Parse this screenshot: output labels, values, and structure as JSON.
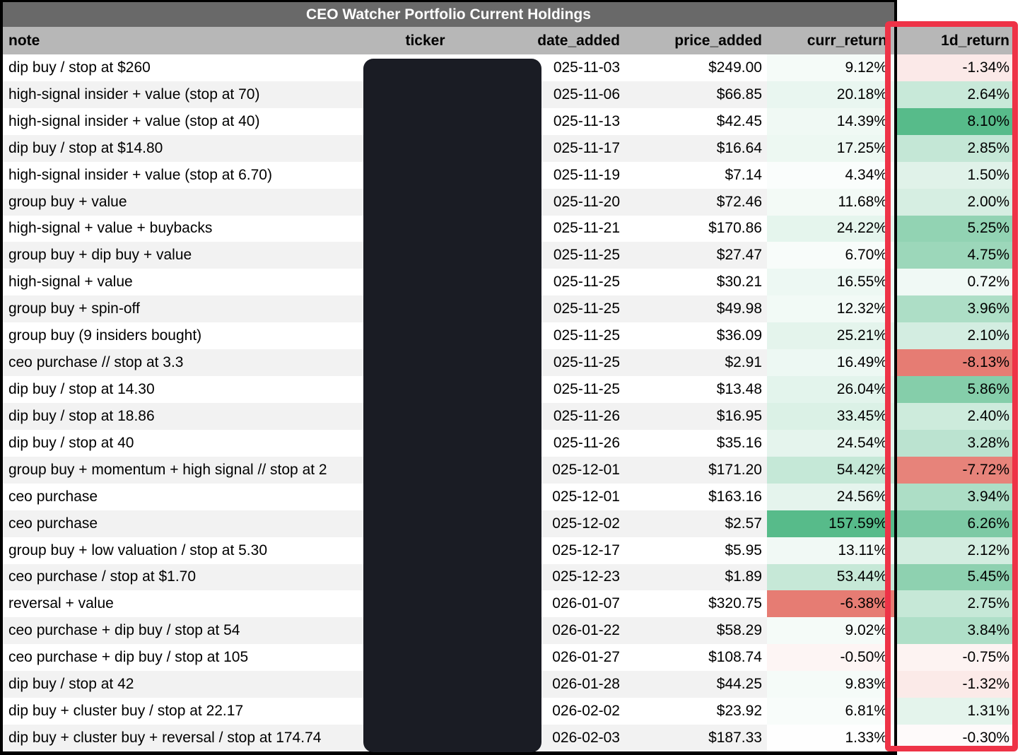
{
  "title": "CEO Watcher Portfolio Current Holdings",
  "columns": {
    "note": "note",
    "ticker": "ticker",
    "date_added": "date_added",
    "price_added": "price_added",
    "curr_return": "curr_return",
    "d1_return": "1d_return"
  },
  "colors": {
    "title_bg": "#696969",
    "header_bg": "#b7b7b7",
    "stripe": "#f2f2f2",
    "border": "#000000",
    "redaction_box": "#1a1c24",
    "highlight_frame": "#ee3347",
    "scale_positive": "#57bb8a",
    "scale_negative": "#e67c73"
  },
  "annotations": {
    "redacted_column": "ticker",
    "highlighted_column": "1d_return"
  },
  "rows": [
    {
      "note": "dip buy / stop at $260",
      "ticker": "",
      "date_added": "025-11-03",
      "price_added": "$249.00",
      "curr_return": 9.12,
      "d1_return": -1.34
    },
    {
      "note": "high-signal insider + value (stop at 70)",
      "ticker": "",
      "date_added": "025-11-06",
      "price_added": "$66.85",
      "curr_return": 20.18,
      "d1_return": 2.64
    },
    {
      "note": "high-signal insider + value (stop at 40)",
      "ticker": "",
      "date_added": "025-11-13",
      "price_added": "$42.45",
      "curr_return": 14.39,
      "d1_return": 8.1
    },
    {
      "note": "dip buy / stop at $14.80",
      "ticker": "",
      "date_added": "025-11-17",
      "price_added": "$16.64",
      "curr_return": 17.25,
      "d1_return": 2.85
    },
    {
      "note": "high-signal insider + value (stop at 6.70)",
      "ticker": "",
      "date_added": "025-11-19",
      "price_added": "$7.14",
      "curr_return": 4.34,
      "d1_return": 1.5
    },
    {
      "note": "group buy + value",
      "ticker": "",
      "date_added": "025-11-20",
      "price_added": "$72.46",
      "curr_return": 11.68,
      "d1_return": 2.0
    },
    {
      "note": "high-signal + value + buybacks",
      "ticker": "",
      "date_added": "025-11-21",
      "price_added": "$170.86",
      "curr_return": 24.22,
      "d1_return": 5.25
    },
    {
      "note": "group buy + dip buy + value",
      "ticker": "",
      "date_added": "025-11-25",
      "price_added": "$27.47",
      "curr_return": 6.7,
      "d1_return": 4.75
    },
    {
      "note": "high-signal + value",
      "ticker": "",
      "date_added": "025-11-25",
      "price_added": "$30.21",
      "curr_return": 16.55,
      "d1_return": 0.72
    },
    {
      "note": "group buy + spin-off",
      "ticker": "",
      "date_added": "025-11-25",
      "price_added": "$49.98",
      "curr_return": 12.32,
      "d1_return": 3.96
    },
    {
      "note": "group buy (9 insiders bought)",
      "ticker": "",
      "date_added": "025-11-25",
      "price_added": "$36.09",
      "curr_return": 25.21,
      "d1_return": 2.1
    },
    {
      "note": "ceo purchase // stop at 3.3",
      "ticker": "",
      "date_added": "025-11-25",
      "price_added": "$2.91",
      "curr_return": 16.49,
      "d1_return": -8.13
    },
    {
      "note": "dip buy / stop at 14.30",
      "ticker": "",
      "date_added": "025-11-25",
      "price_added": "$13.48",
      "curr_return": 26.04,
      "d1_return": 5.86
    },
    {
      "note": "dip buy / stop at 18.86",
      "ticker": "",
      "date_added": "025-11-26",
      "price_added": "$16.95",
      "curr_return": 33.45,
      "d1_return": 2.4
    },
    {
      "note": "dip buy / stop at 40",
      "ticker": "",
      "date_added": "025-11-26",
      "price_added": "$35.16",
      "curr_return": 24.54,
      "d1_return": 3.28
    },
    {
      "note": "group buy + momentum + high signal // stop at 2",
      "ticker": "",
      "date_added": "025-12-01",
      "price_added": "$171.20",
      "curr_return": 54.42,
      "d1_return": -7.72
    },
    {
      "note": "ceo purchase",
      "ticker": "",
      "date_added": "025-12-01",
      "price_added": "$163.16",
      "curr_return": 24.56,
      "d1_return": 3.94
    },
    {
      "note": "ceo purchase",
      "ticker": "",
      "date_added": "025-12-02",
      "price_added": "$2.57",
      "curr_return": 157.59,
      "d1_return": 6.26
    },
    {
      "note": "group buy + low valuation / stop at 5.30",
      "ticker": "",
      "date_added": "025-12-17",
      "price_added": "$5.95",
      "curr_return": 13.11,
      "d1_return": 2.12
    },
    {
      "note": "ceo purchase / stop at $1.70",
      "ticker": "",
      "date_added": "025-12-23",
      "price_added": "$1.89",
      "curr_return": 53.44,
      "d1_return": 5.45
    },
    {
      "note": "reversal + value",
      "ticker": "",
      "date_added": "026-01-07",
      "price_added": "$320.75",
      "curr_return": -6.38,
      "d1_return": 2.75
    },
    {
      "note": "ceo purchase + dip buy / stop at 54",
      "ticker": "",
      "date_added": "026-01-22",
      "price_added": "$58.29",
      "curr_return": 9.02,
      "d1_return": 3.84
    },
    {
      "note": "ceo purchase + dip buy / stop at 105",
      "ticker": "",
      "date_added": "026-01-27",
      "price_added": "$108.74",
      "curr_return": -0.5,
      "d1_return": -0.75
    },
    {
      "note": "dip buy / stop at 42",
      "ticker": "",
      "date_added": "026-01-28",
      "price_added": "$44.25",
      "curr_return": 9.83,
      "d1_return": -1.32
    },
    {
      "note": "dip buy + cluster buy / stop at 22.17",
      "ticker": "",
      "date_added": "026-02-02",
      "price_added": "$23.92",
      "curr_return": 6.81,
      "d1_return": 1.31
    },
    {
      "note": "dip buy + cluster buy + reversal / stop at 174.74",
      "ticker": "",
      "date_added": "026-02-03",
      "price_added": "$187.33",
      "curr_return": 1.33,
      "d1_return": -0.3
    }
  ]
}
